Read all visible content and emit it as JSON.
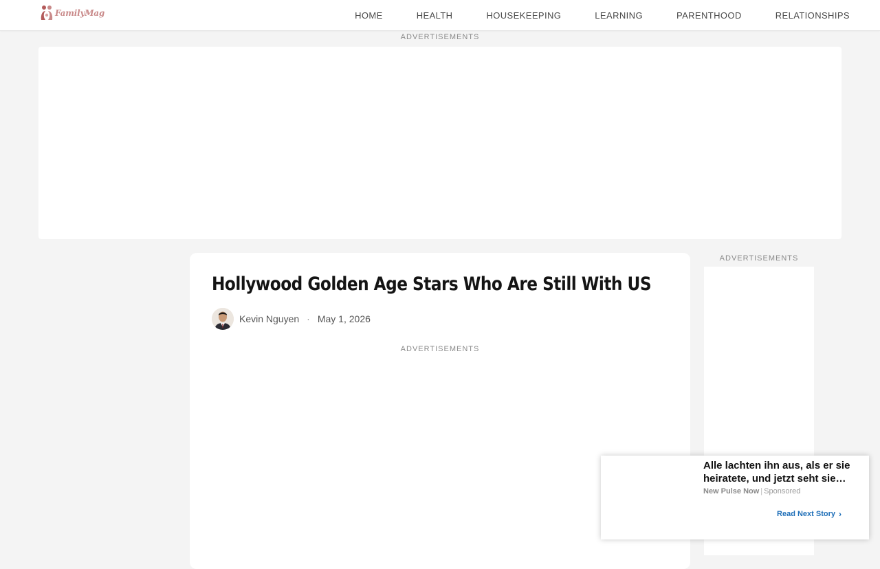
{
  "header": {
    "logo_text": "FamilyMag",
    "nav": [
      "HOME",
      "HEALTH",
      "HOUSEKEEPING",
      "LEARNING",
      "PARENTHOOD",
      "RELATIONSHIPS"
    ]
  },
  "ads": {
    "label_top": "ADVERTISEMENTS",
    "label_side": "ADVERTISEMENTS",
    "label_inline": "ADVERTISEMENTS"
  },
  "article": {
    "title": "Hollywood Golden Age Stars Who Are Still With US",
    "author": "Kevin Nguyen",
    "separator": "·",
    "date": "May 1, 2026"
  },
  "popup": {
    "headline": "Alle lachten ihn aus, als er sie heiratete, und jetzt seht sie…",
    "brand": "New Pulse Now",
    "divider": "|",
    "sponsored": "Sponsored",
    "cta": "Read Next Story",
    "cta_icon": "chevron-right-icon"
  },
  "colors": {
    "page_bg": "#f4f4f4",
    "logo_accent": "#c98a8a",
    "cta_blue": "#1f6fb8"
  }
}
